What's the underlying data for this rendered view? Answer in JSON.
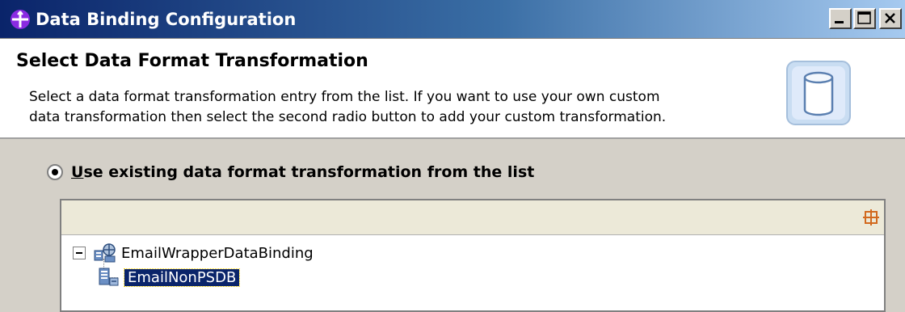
{
  "window": {
    "title": "Data Binding Configuration",
    "controls": {
      "minimize_icon": "minimize-icon",
      "maximize_icon": "maximize-icon",
      "close_icon": "close-icon"
    }
  },
  "header": {
    "title": "Select Data Format Transformation",
    "description": "Select a data format transformation entry from the list.  If you want to use your own custom\ndata transformation then select the second radio button to add your custom transformation.",
    "icon": "database-cylinder-icon"
  },
  "options": {
    "use_existing": {
      "mnemonic": "U",
      "label_rest": "se existing data format transformation from the list",
      "selected": true
    }
  },
  "tree": {
    "toolbar_icon": "collapse-all-icon",
    "root": {
      "label": "EmailWrapperDataBinding",
      "expanded": true,
      "icon": "data-binding-icon"
    },
    "children": [
      {
        "label": "EmailNonPSDB",
        "selected": true,
        "icon": "data-handler-icon"
      }
    ]
  },
  "colors": {
    "titlebar_start": "#0a246a",
    "titlebar_end": "#a6caf0",
    "selection": "#0a246a",
    "dialog_background": "#d4d0c8"
  }
}
